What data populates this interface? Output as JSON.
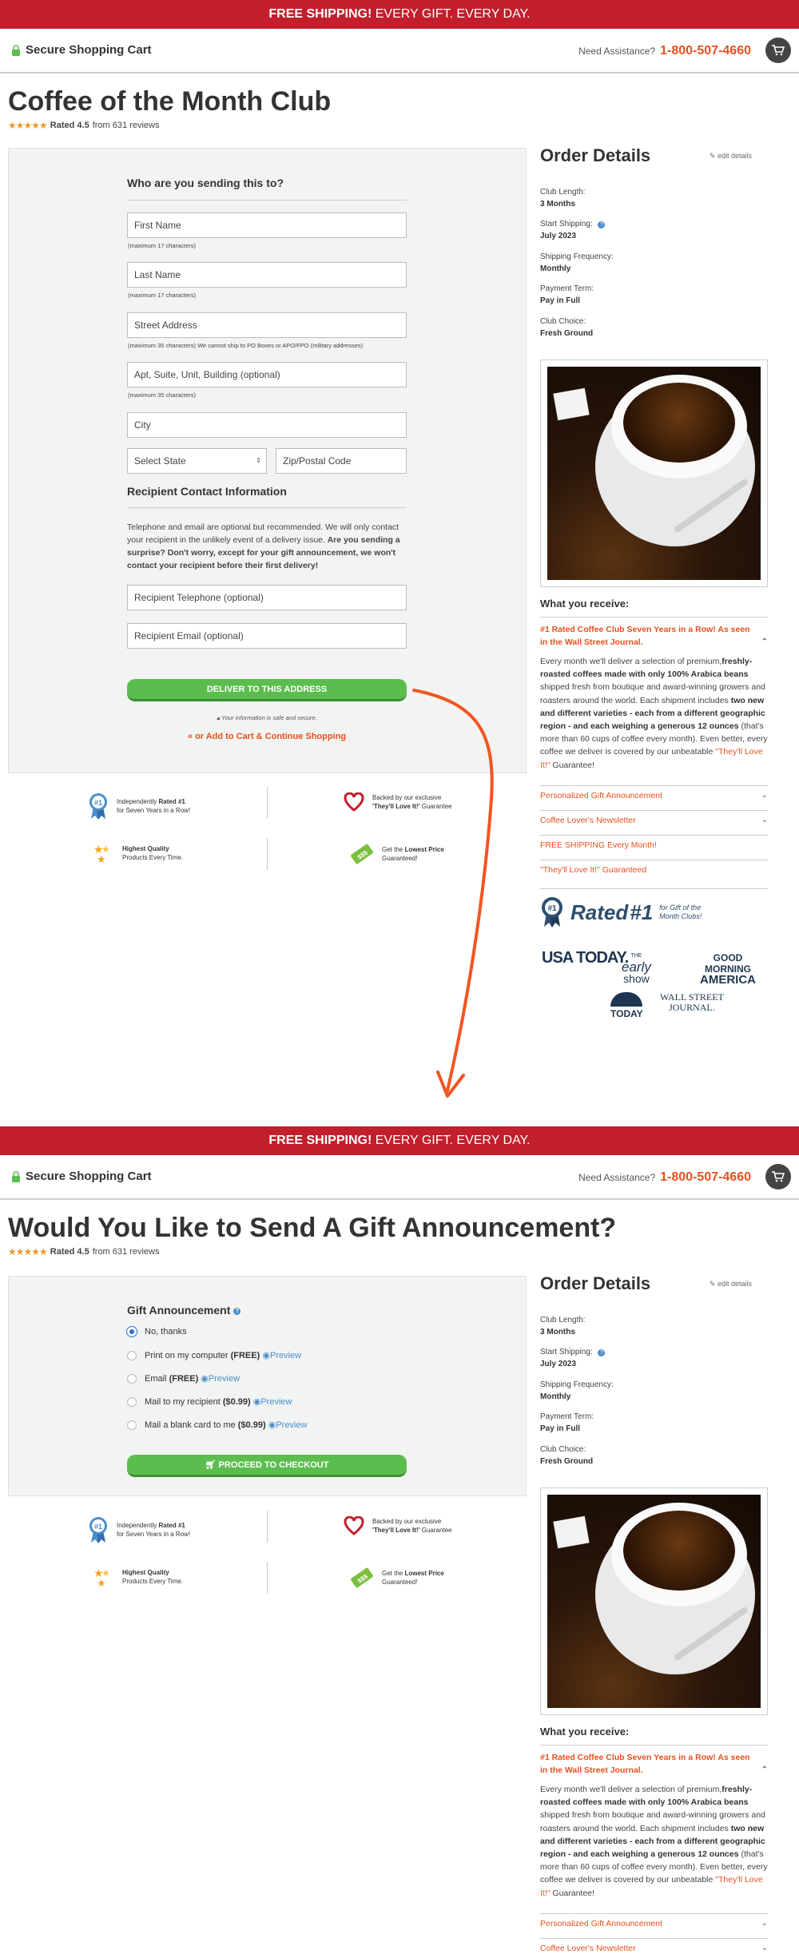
{
  "banner": {
    "bold": "FREE SHIPPING!",
    "rest": " EVERY GIFT. EVERY DAY."
  },
  "header": {
    "secure_label": "Secure Shopping Cart",
    "assist_label": "Need Assistance?",
    "phone": "1-800-507-4660"
  },
  "page1": {
    "title": "Coffee of the Month Club",
    "rating_label": "Rated 4.5",
    "rating_count": "from 631 reviews",
    "rating_value": 4.5,
    "form": {
      "section_title": "Who are you sending this to?",
      "first_name_placeholder": "First Name",
      "first_name_hint": "(maximum 17 characters)",
      "last_name_placeholder": "Last Name",
      "last_name_hint": "(maximum 17 characters)",
      "street_placeholder": "Street Address",
      "street_hint": "(maximum 35 characters) We cannot ship to PO Boxes or APO/FPO (military addresses)",
      "apt_placeholder": "Apt, Suite, Unit, Building (optional)",
      "apt_hint": "(maximum 35 characters)",
      "city_placeholder": "City",
      "state_select": "Select State",
      "zip_placeholder": "Zip/Postal Code",
      "contact_title": "Recipient Contact Information",
      "contact_text_1": "Telephone and email are optional but recommended. We will only contact your recipient in the unlikely event of a delivery issue.",
      "contact_text_2": " Are you sending a surprise? Don't worry, except for your gift announcement, we won't contact your recipient before their first delivery!",
      "phone_placeholder": "Recipient Telephone (optional)",
      "email_placeholder": "Recipient Email (optional)",
      "deliver_button": "DELIVER TO THIS ADDRESS",
      "safe_text": "Your information is safe and secure.",
      "add_to_cart": "« or Add to Cart & Continue Shopping"
    }
  },
  "trust": {
    "rated_pre": "Independently ",
    "rated_bold": "Rated #1",
    "rated_post": "for Seven Years in a Row!",
    "backed_pre": "Backed by our exclusive",
    "backed_bold": "'They'll Love It!'",
    "backed_post": " Guarantee",
    "quality_bold": "Highest Quality",
    "quality_post": "Products Every Time.",
    "price_pre": "Get the ",
    "price_bold": "Lowest Price",
    "price_post": "Guaranteed!",
    "price_tag": "$$$"
  },
  "order": {
    "title": "Order Details",
    "edit": "edit details",
    "club_length_label": "Club Length:",
    "club_length": "3 Months",
    "start_label": "Start Shipping:",
    "start": "July 2023",
    "freq_label": "Shipping Frequency:",
    "freq": "Monthly",
    "term_label": "Payment Term:",
    "term": "Pay in Full",
    "choice_label": "Club Choice:",
    "choice": "Fresh Ground",
    "receive_title": "What you receive:",
    "acc1_title": "#1 Rated Coffee Club Seven Years in a Row! As seen in the Wall Street Journal.",
    "acc1_p1": "Every month we'll deliver a selection of premium,",
    "acc1_b1": "freshly-roasted coffees made with only 100% Arabica beans",
    "acc1_p2": " shipped fresh from boutique and award-winning growers and roasters around the world. Each shipment includes ",
    "acc1_b2": "two new and different varieties - each from a different geographic region - and each weighing a generous 12 ounces",
    "acc1_p3": " (that's more than 60 cups of coffee every month). Even better, every coffee we deliver is covered by our unbeatable ",
    "acc1_o": "\"They'll Love It!\"",
    "acc1_p4": " Guarantee!",
    "acc2": "Personalized Gift Announcement",
    "acc3": "Coffee Lover's Newsletter",
    "acc4": "FREE SHIPPING Every Month!",
    "acc5": "\"They'll Love It!\" Guaranteed",
    "rated_big": "Rated",
    "rated_num": "#1",
    "rated_sub": "for Gift of the Month Clubs!",
    "press": {
      "usa": "USA TODAY.",
      "early1": "THE",
      "early2": "early",
      "early3": "show",
      "gma1": "GOOD",
      "gma2": "MORNING",
      "gma3": "AMERICA",
      "today": "TODAY",
      "wsj1": "WALL STREET",
      "wsj2": "JOURNAL."
    }
  },
  "page2": {
    "title": "Would You Like to Send A Gift Announcement?",
    "rating_label": "Rated 4.5",
    "rating_count": "from 631 reviews",
    "gift_title": "Gift Announcement",
    "opt1": "No, thanks",
    "opt2_a": "Print on my computer ",
    "opt2_b": "(FREE)",
    "opt3_a": "Email ",
    "opt3_b": "(FREE)",
    "opt4_a": "Mail to my recipient ",
    "opt4_b": "($0.99)",
    "opt5_a": "Mail a blank card to me ",
    "opt5_b": "($0.99)",
    "preview": "Preview",
    "checkout": "PROCEED TO CHECKOUT",
    "selected_option": "No, thanks"
  },
  "colors": {
    "brand_red": "#c21e2c",
    "accent_orange": "#e8501e",
    "button_green": "#5cbd4f",
    "link_blue": "#4a8ec9"
  }
}
